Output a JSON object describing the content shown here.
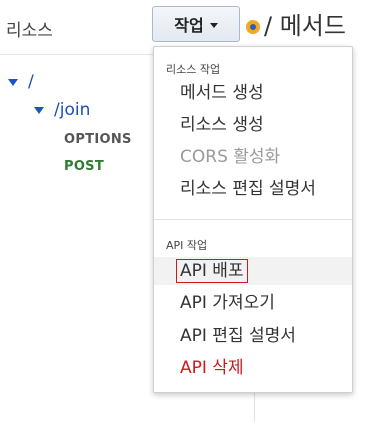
{
  "left_panel": {
    "title": "리소스",
    "tree": [
      {
        "label": "/"
      },
      {
        "label": "/join"
      }
    ],
    "methods": [
      {
        "label": "OPTIONS",
        "color": "#555555"
      },
      {
        "label": "POST",
        "color": "#2e7d32"
      }
    ]
  },
  "toolbar": {
    "actions_label": "작업"
  },
  "right_panel": {
    "title": "/ 메서드"
  },
  "actions_menu": {
    "resource_section": {
      "label": "리소스 작업",
      "items": [
        {
          "label": "메서드 생성"
        },
        {
          "label": "리소스 생성"
        },
        {
          "label": "CORS 활성화",
          "state": "disabled"
        },
        {
          "label": "리소스 편집 설명서"
        }
      ]
    },
    "api_section": {
      "label": "API 작업",
      "items": [
        {
          "label": "API 배포",
          "state": "hover-highlighted"
        },
        {
          "label": "API 가져오기"
        },
        {
          "label": "API 편집 설명서"
        },
        {
          "label": "API 삭제",
          "state": "danger"
        }
      ]
    }
  },
  "colors": {
    "link": "#1a4fb8",
    "danger": "#d0191d",
    "disabled": "#9a9a9a",
    "post": "#2e7d32"
  }
}
